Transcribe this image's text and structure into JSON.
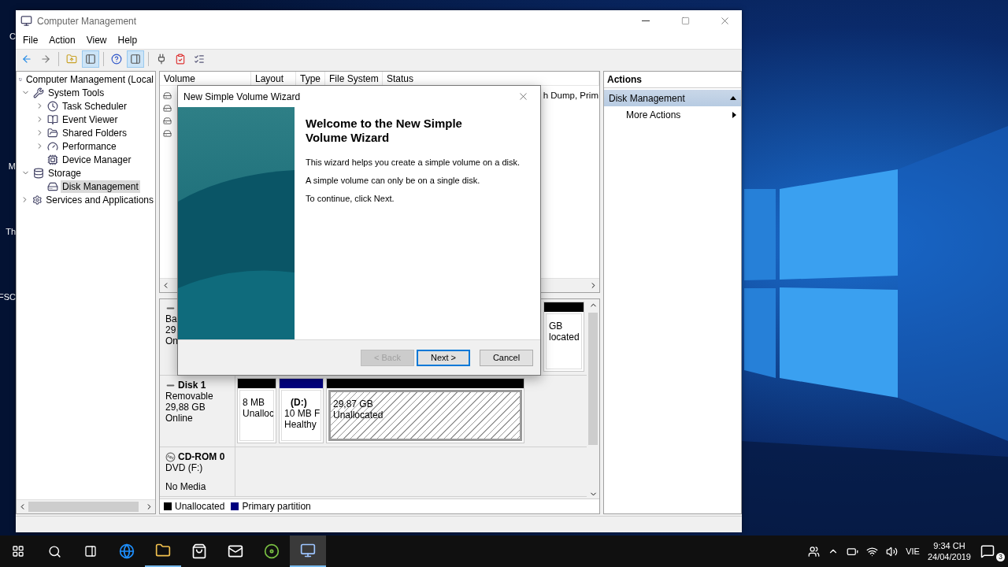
{
  "desktop_labels": [
    "C",
    "M",
    "Th",
    "FSC"
  ],
  "window": {
    "title": "Computer Management"
  },
  "menu": [
    "File",
    "Action",
    "View",
    "Help"
  ],
  "toolbar": [
    {
      "pressed": false
    },
    {
      "pressed": false
    },
    {
      "pressed": false
    },
    {
      "pressed": true
    },
    {
      "pressed": false
    },
    {
      "pressed": true
    },
    {
      "pressed": false
    },
    {
      "pressed": false
    },
    {
      "pressed": false
    }
  ],
  "tree": [
    {
      "label": "Computer Management (Local",
      "selected": false,
      "children": [
        {
          "label": "System Tools",
          "expanded": true,
          "selected": false,
          "children": [
            {
              "label": "Task Scheduler",
              "expanded": false,
              "selected": false
            },
            {
              "label": "Event Viewer",
              "expanded": false,
              "selected": false
            },
            {
              "label": "Shared Folders",
              "expanded": false,
              "selected": false
            },
            {
              "label": "Performance",
              "expanded": false,
              "selected": false
            },
            {
              "label": "Device Manager",
              "selected": false
            }
          ]
        },
        {
          "label": "Storage",
          "expanded": true,
          "selected": false,
          "children": [
            {
              "label": "Disk Management",
              "selected": true
            }
          ]
        },
        {
          "label": "Services and Applications",
          "expanded": false,
          "selected": false
        }
      ]
    }
  ],
  "volume_list": {
    "columns": [
      "Volume",
      "Layout",
      "Type",
      "File System",
      "Status"
    ],
    "rows": [
      {
        "status": "h Dump, Prim"
      },
      {},
      {},
      {}
    ]
  },
  "disks": [
    {
      "kind": "disk",
      "lines": [
        "Ba",
        "29",
        "On"
      ],
      "partitions": [
        {
          "lines": [
            "GB",
            "located"
          ],
          "color": "#000000",
          "selected": false
        }
      ]
    },
    {
      "kind": "disk",
      "name": "Disk 1",
      "lines": [
        "Removable",
        "29,88 GB",
        "Online"
      ],
      "partitions": [
        {
          "lines": [
            "8 MB",
            "Unalloc"
          ],
          "color": "#000000",
          "selected": false
        },
        {
          "title": "(D:)",
          "lines": [
            "10 MB F",
            "Healthy"
          ],
          "color": "#00007f",
          "selected": false
        },
        {
          "lines": [
            "29,87 GB",
            "Unallocated"
          ],
          "color": "#000000",
          "selected": true
        }
      ]
    },
    {
      "kind": "cdrom",
      "name": "CD-ROM 0",
      "lines": [
        "DVD (F:)"
      ],
      "footer": "No Media"
    }
  ],
  "legend": [
    {
      "label": "Unallocated",
      "color": "#000000"
    },
    {
      "label": "Primary partition",
      "color": "#00007f"
    }
  ],
  "actions": {
    "title": "Actions",
    "sections": [
      {
        "label": "Disk Management",
        "expanded": true,
        "items": [
          "More Actions"
        ]
      }
    ]
  },
  "dialog": {
    "title": "New Simple Volume Wizard",
    "heading": "Welcome to the New Simple Volume Wizard",
    "paragraphs": [
      "This wizard helps you create a simple volume on a disk.",
      "A simple volume can only be on a single disk.",
      "To continue, click Next."
    ],
    "buttons": [
      {
        "label": "< Back",
        "disabled": true,
        "default": false
      },
      {
        "label": "Next >",
        "disabled": false,
        "default": true
      },
      {
        "label": "Cancel",
        "disabled": false,
        "default": false
      }
    ]
  },
  "taskbar": {
    "apps": [
      {
        "running": false,
        "selected": false
      },
      {
        "running": true,
        "selected": false
      },
      {
        "running": false,
        "selected": false
      },
      {
        "running": false,
        "selected": false
      },
      {
        "running": false,
        "selected": false
      },
      {
        "running": true,
        "selected": true
      }
    ],
    "language": "VIE",
    "time": "9:34 CH",
    "date": "24/04/2019",
    "notifications": "3"
  }
}
